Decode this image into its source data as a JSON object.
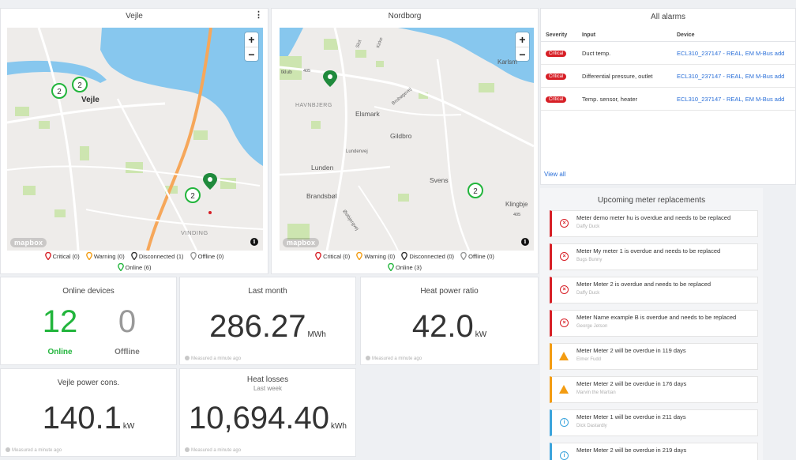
{
  "colors": {
    "critical": "#d71f26",
    "warning": "#f39c12",
    "info": "#3ba4dc",
    "online_green": "#22b53c",
    "link": "#2a6fd8",
    "water": "#87c7ee",
    "park": "#cde5b0"
  },
  "maps": [
    {
      "title": "Vejle",
      "zoom_in": "+",
      "zoom_out": "−",
      "logo": "mapbox",
      "labels": {
        "city": "Vejle",
        "district": "VINDING"
      },
      "clusters": [
        "2",
        "2",
        "2"
      ],
      "legend": {
        "critical": "Critical (0)",
        "warning": "Warning (0)",
        "disconnected": "Disconnected (1)",
        "offline": "Offline (0)",
        "online": "Online (6)"
      }
    },
    {
      "title": "Nordborg",
      "zoom_in": "+",
      "zoom_out": "−",
      "logo": "mapbox",
      "labels": {
        "karlsminde": "Karlsm",
        "havnbjerg": "HAVNBJERG",
        "elsmark": "Elsmark",
        "gildbro": "Gildbro",
        "lundenvej": "Lundenvej",
        "lunden": "Lunden",
        "brandsbol": "Brandsbøl",
        "svenstrup": "Svens",
        "klingbjerg": "Klingbje",
        "ostbjergvej": "Østbjergvej",
        "brobakkevej": "Brobøgevej",
        "slot": "Slot",
        "kirke": "Kirke",
        "klub": "tklub",
        "road1": "405",
        "road2": "405"
      },
      "clusters": [
        "2"
      ],
      "legend": {
        "critical": "Critical (0)",
        "warning": "Warning (0)",
        "disconnected": "Disconnected (0)",
        "offline": "Offline (0)",
        "online": "Online (3)"
      }
    }
  ],
  "alarms": {
    "title": "All alarms",
    "headers": [
      "Severity",
      "Input",
      "Device"
    ],
    "rows": [
      {
        "severity": "Critical",
        "input": "Duct temp.",
        "device": "ECL310_237147 - REAL, EM M-Bus add"
      },
      {
        "severity": "Critical",
        "input": "Differential pressure, outlet",
        "device": "ECL310_237147 - REAL, EM M-Bus add"
      },
      {
        "severity": "Critical",
        "input": "Temp. sensor, heater",
        "device": "ECL310_237147 - REAL, EM M-Bus add"
      }
    ],
    "view_all": "View all"
  },
  "online_devices": {
    "title": "Online devices",
    "online_value": "12",
    "offline_value": "0",
    "online_label": "Online",
    "offline_label": "Offline"
  },
  "last_month": {
    "title": "Last month",
    "value": "286.27",
    "unit": "MWh",
    "measured": "Measured a minute ago"
  },
  "heat_power_ratio": {
    "title": "Heat power ratio",
    "value": "42.0",
    "unit": "kW",
    "measured": "Measured a minute ago"
  },
  "vejle_power": {
    "title": "Vejle power cons.",
    "value": "140.1",
    "unit": "kW",
    "measured": "Measured a minute ago"
  },
  "heat_losses": {
    "title": "Heat losses",
    "subtitle": "Last week",
    "value": "10,694.40",
    "unit": "kWh",
    "measured": "Measured a minute ago"
  },
  "replacements": {
    "title": "Upcoming meter replacements",
    "items": [
      {
        "level": "critical",
        "icon": "⊗",
        "message": "Meter demo meter hu is overdue and needs to be replaced",
        "person": "Daffy Duck"
      },
      {
        "level": "critical",
        "icon": "⊗",
        "message": "Meter My meter 1 is overdue and needs to be replaced",
        "person": "Bugs Bunny"
      },
      {
        "level": "critical",
        "icon": "⊗",
        "message": "Meter Meter 2 is overdue and needs to be replaced",
        "person": "Daffy Duck"
      },
      {
        "level": "critical",
        "icon": "⊗",
        "message": "Meter Name example B is overdue and needs to be replaced",
        "person": "George Jetson"
      },
      {
        "level": "warning",
        "icon": "!",
        "message": "Meter Meter 2 will be overdue in 119 days",
        "person": "Elmer Fudd"
      },
      {
        "level": "warning",
        "icon": "!",
        "message": "Meter Meter 2 will be overdue in 176 days",
        "person": "Marvin the Martian"
      },
      {
        "level": "info",
        "icon": "i",
        "message": "Meter Meter 1 will be overdue in 211 days",
        "person": "Dick Dastardly"
      },
      {
        "level": "info",
        "icon": "i",
        "message": "Meter Meter 2 will be overdue in 219 days",
        "person": ""
      }
    ]
  }
}
